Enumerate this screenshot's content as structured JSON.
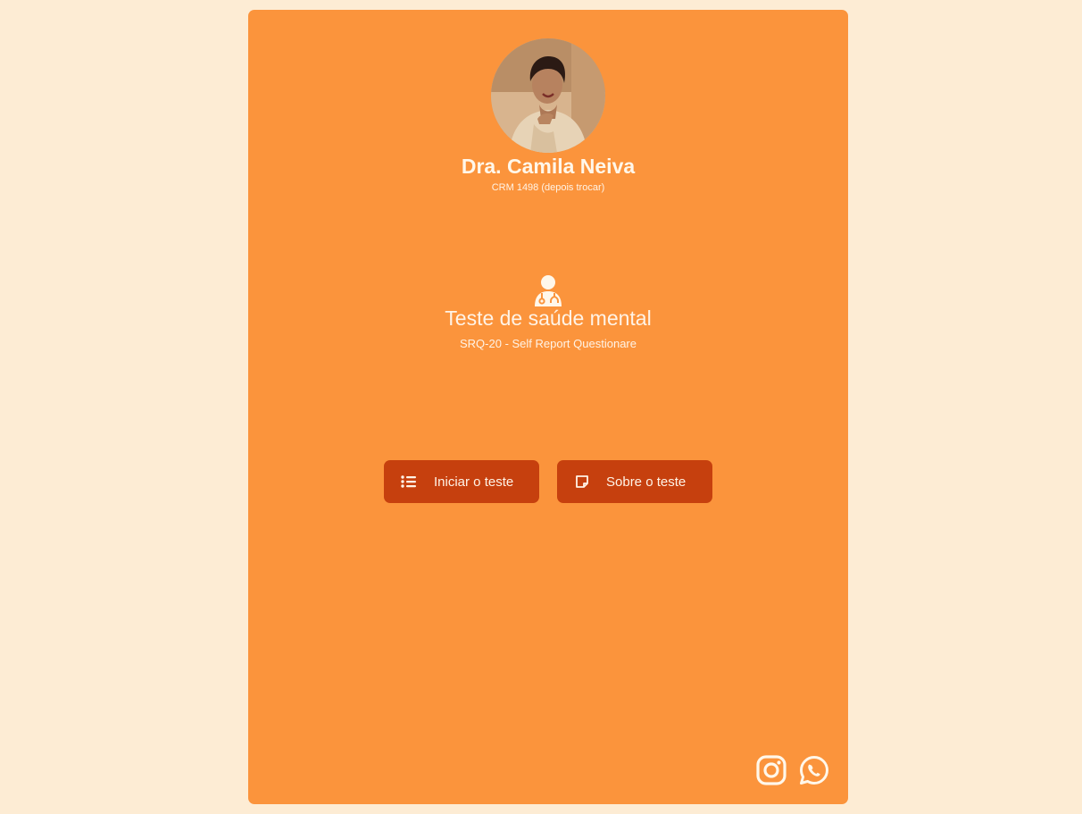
{
  "profile": {
    "name": "Dra. Camila Neiva",
    "crm": "CRM 1498 (depois trocar)",
    "avatar_alt": "Dra. Camila Neiva"
  },
  "test": {
    "icon": "doctor-icon",
    "title": "Teste de saúde mental",
    "subtitle": "SRQ-20 - Self Report Questionare"
  },
  "actions": {
    "start": {
      "label": "Iniciar o teste",
      "icon": "list-icon"
    },
    "about": {
      "label": "Sobre o teste",
      "icon": "note-icon"
    }
  },
  "social": [
    {
      "name": "Instagram",
      "icon": "instagram-icon"
    },
    {
      "name": "WhatsApp",
      "icon": "whatsapp-icon"
    }
  ],
  "colors": {
    "page_background": "#fdecd4",
    "card_background": "#fb943c",
    "button_background": "#c6400e",
    "text_light": "#fff3e6"
  }
}
